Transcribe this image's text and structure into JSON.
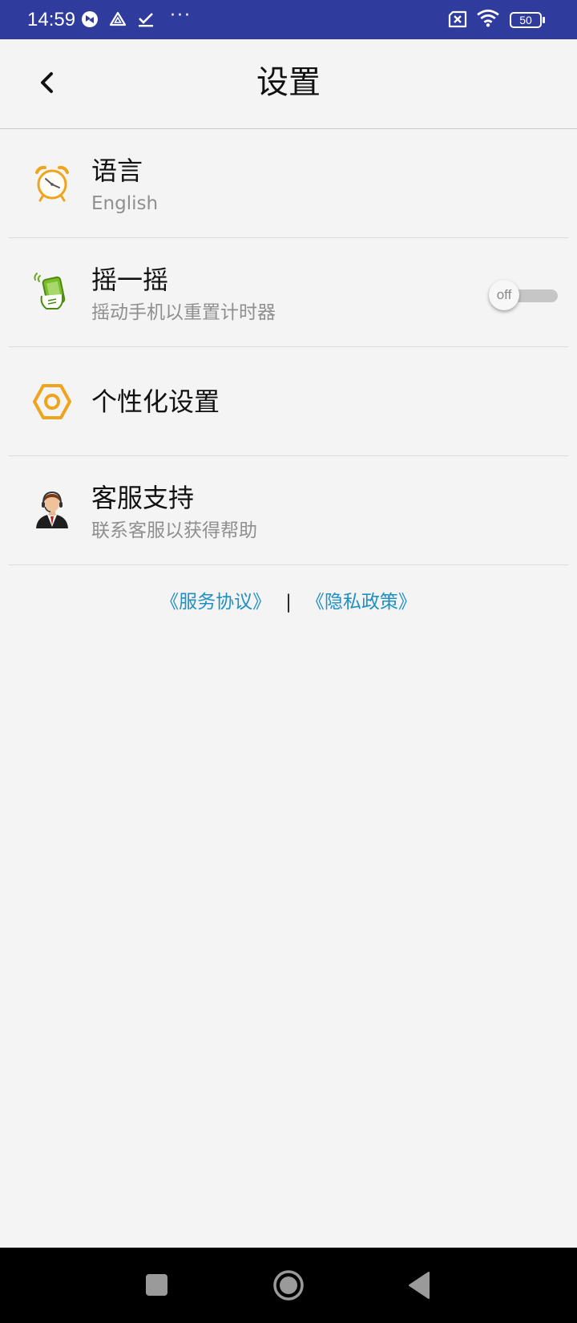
{
  "status_bar": {
    "time": "14:59",
    "dots": "···",
    "battery": "50",
    "icons": [
      "nfc-icon",
      "drive-icon",
      "check-icon",
      "sim-error-icon",
      "wifi-icon",
      "battery-icon"
    ]
  },
  "header": {
    "title": "设置",
    "back_icon": "chevron-left-icon"
  },
  "settings": [
    {
      "title": "语言",
      "subtitle": "English",
      "icon": "alarm-clock-icon"
    },
    {
      "title": "摇一摇",
      "subtitle": "摇动手机以重置计时器",
      "icon": "shake-phone-icon",
      "toggle_label": "off",
      "toggle_on": false
    },
    {
      "title": "个性化设置",
      "subtitle": "",
      "icon": "hexagon-icon"
    },
    {
      "title": "客服支持",
      "subtitle": "联系客服以获得帮助",
      "icon": "support-agent-icon"
    }
  ],
  "footer": {
    "service_agreement": "《服务协议》",
    "separator": "|",
    "privacy_policy": "《隐私政策》"
  },
  "nav_bar": {
    "icons": [
      "recents-square-icon",
      "home-circle-icon",
      "back-triangle-icon"
    ]
  },
  "colors": {
    "status_bar": "#2f3c9e",
    "background": "#f4f4f4",
    "link": "#1f8fc4",
    "icon_orange": "#f0a41e",
    "icon_green": "#6aaa1e"
  }
}
